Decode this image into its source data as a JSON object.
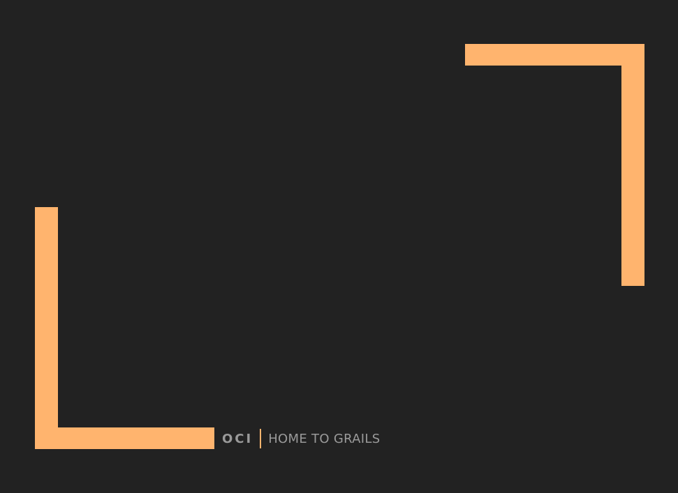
{
  "colors": {
    "background": "#222222",
    "accent": "#ffb46e",
    "logo_text": "#9a9a9a",
    "tagline_text": "#9a9a9a"
  },
  "brand": {
    "logo": "OCI",
    "tagline": "HOME TO GRAILS"
  }
}
